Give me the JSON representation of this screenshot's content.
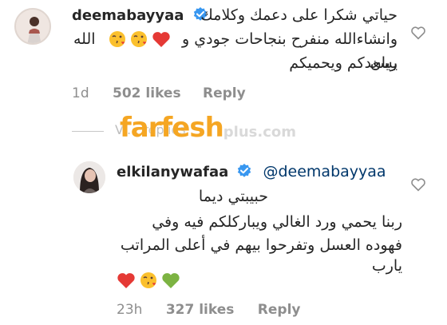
{
  "comment1": {
    "username": "deemabayyaa",
    "lines": [
      "حياتي شكرا على دعمك وكلامك",
      "وانشاءالله منفرح بنجاحات جودي و ريان",
      "يسعدكم ويحميكم"
    ],
    "line2_suffix": "الله",
    "time": "1d",
    "likes": "502 likes",
    "reply_label": "Reply"
  },
  "view_replies_partial": "Vi... replies",
  "watermark": {
    "brand": "farfesh",
    "suffix": "plus.com"
  },
  "reply1": {
    "username": "elkilanywafaa",
    "mention": "@deemabayyaa",
    "lines": [
      "حبيبتي ديما",
      "ربنا يحمي ورد الغالي ويباركلكم فيه وفي",
      "فهوده العسل وتفرحوا بيهم في أعلى المراتب",
      "يارب"
    ],
    "time": "23h",
    "likes": "327 likes",
    "reply_label": "Reply"
  },
  "icons": {
    "verified": "verified-badge-icon",
    "like": "heart-outline-icon",
    "emoji_red_heart": "red-heart-emoji",
    "emoji_kiss": "face-blowing-kiss-emoji",
    "emoji_green_heart": "green-heart-emoji"
  },
  "colors": {
    "verified": "#3897f0",
    "username": "#262626",
    "meta": "#8e8e8e",
    "mention": "#00376b",
    "watermark_orange": "#f5a623"
  }
}
